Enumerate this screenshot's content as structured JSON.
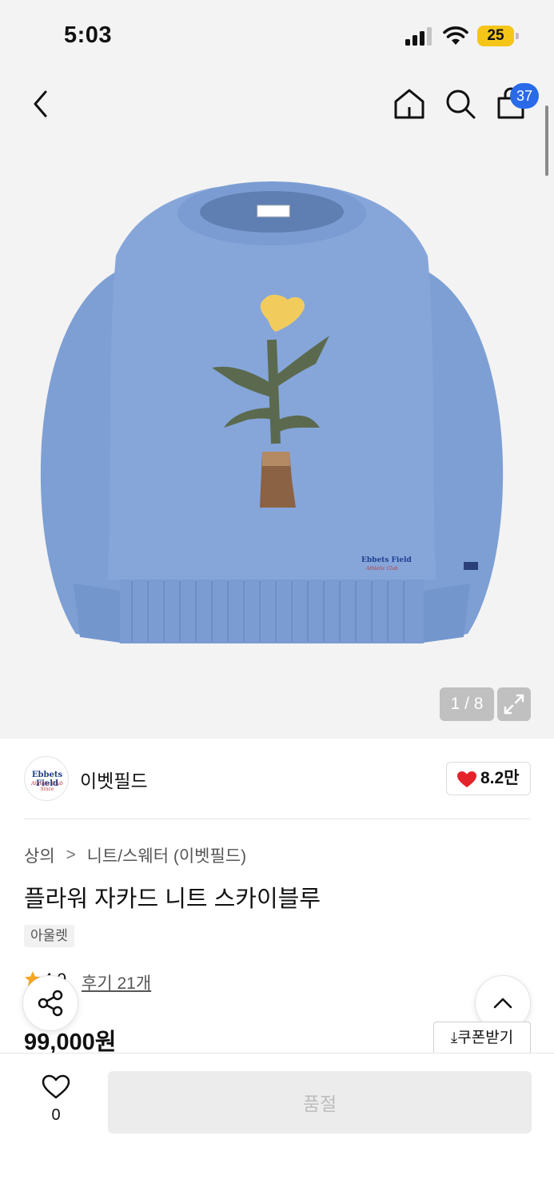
{
  "status_bar": {
    "time": "5:03",
    "battery": "25"
  },
  "nav": {
    "cart_count": "37"
  },
  "gallery": {
    "page_counter": "1 / 8"
  },
  "brand": {
    "name": "이벳필드",
    "logo_text": "Ebbets Field",
    "logo_sub": "Athletic Club Since",
    "likes": "8.2만"
  },
  "breadcrumb": {
    "category": "상의",
    "separator": ">",
    "subcategory": "니트/스웨터 (이벳필드)"
  },
  "product": {
    "title": "플라워 자카드 니트 스카이블루",
    "tag": "아울렛",
    "rating": "4.9",
    "reviews": "후기 21개",
    "price": "99,000원"
  },
  "coupon": {
    "label": "쿠폰받기",
    "icon": "download-icon"
  },
  "bottom_bar": {
    "wish_count": "0",
    "soldout_label": "품절"
  },
  "colors": {
    "accent": "#2a6ae8",
    "heart": "#e5222a",
    "star": "#f5a623",
    "battery": "#f5c518"
  }
}
